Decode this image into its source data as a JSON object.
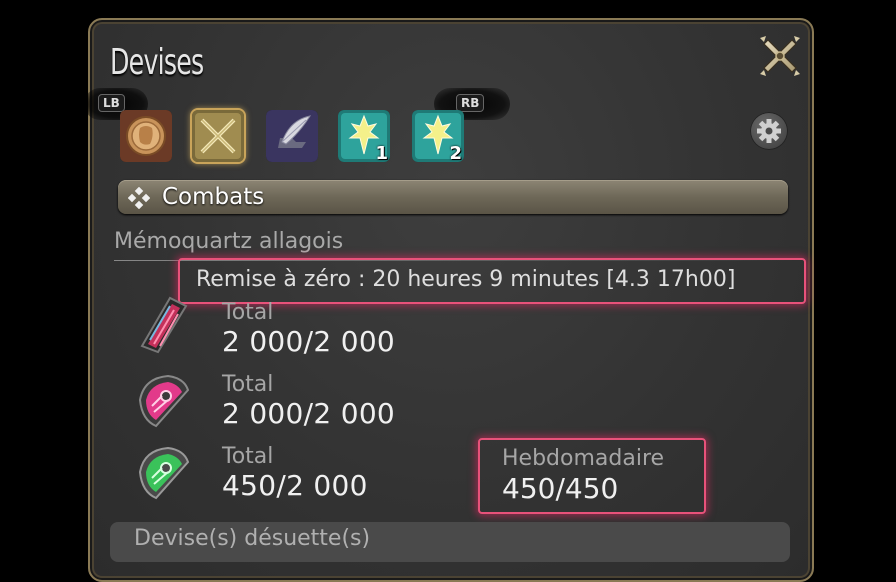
{
  "window": {
    "title": "Devises"
  },
  "bumpers": {
    "left": "LB",
    "right": "RB"
  },
  "tabs": [
    {
      "icon": "gil-coin-icon",
      "selected": false
    },
    {
      "icon": "crossed-swords-icon",
      "selected": true
    },
    {
      "icon": "quill-anvil-icon",
      "selected": false
    },
    {
      "icon": "scrip-crystal-icon",
      "badge": "1",
      "selected": false
    },
    {
      "icon": "scrip-crystal-icon",
      "badge": "2",
      "selected": false
    }
  ],
  "category": {
    "label": "Combats"
  },
  "section": {
    "title": "Mémoquartz allagois",
    "reset_text": "Remise à zéro : 20 heures 9 minutes [4.3 17h00]"
  },
  "currencies": [
    {
      "icon": "red-tome-icon",
      "total_label": "Total",
      "total_value": "2 000/2 000"
    },
    {
      "icon": "pink-tome-icon",
      "total_label": "Total",
      "total_value": "2 000/2 000"
    },
    {
      "icon": "green-tome-icon",
      "total_label": "Total",
      "total_value": "450/2 000",
      "weekly_label": "Hebdomadaire",
      "weekly_value": "450/450"
    }
  ],
  "obsolete": {
    "label": "Devise(s) désuette(s)"
  },
  "colors": {
    "highlight": "#e8527a",
    "frame_gold": "#8a7a55",
    "panel_bg": "#363636",
    "category_bar": "#7a7364"
  }
}
